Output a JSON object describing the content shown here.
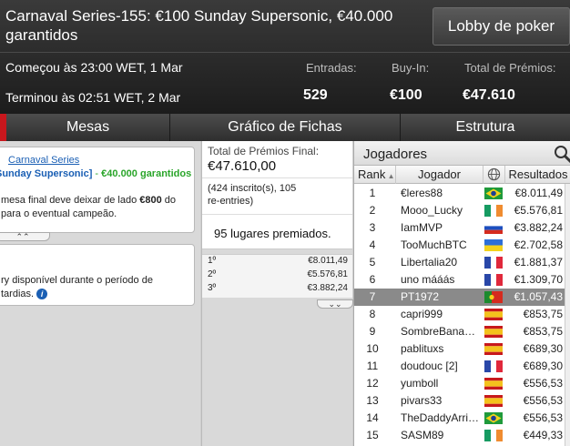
{
  "header": {
    "title": "Carnaval Series-155: €100 Sunday Supersonic, €40.000 garantidos",
    "lobby_button": "Lobby de poker",
    "started": "Começou às 23:00 WET, 1 Mar",
    "ended": "Terminou às 02:51 WET, 2 Mar",
    "entries_label": "Entradas:",
    "entries_value": "529",
    "buyin_label": "Buy-In:",
    "buyin_value": "€100",
    "prize_label": "Total de Prémios:",
    "prize_value": "€47.610"
  },
  "tabs": [
    "Mesas",
    "Gráfico de Fichas",
    "Estrutura"
  ],
  "left": {
    "series_link": "Carnaval Series",
    "event_name": "Sunday Supersonic]",
    "guarantee": "€40.000 garantidos",
    "desc_pre": "mesa final deve deixar de lado ",
    "desc_amount": "€800",
    "desc_post": " do",
    "desc_line2": "para o eventual campeão.",
    "late_line1": "ry disponível durante o período de",
    "late_line2": "tardias."
  },
  "middle": {
    "final_label": "Total de Prémios Final:",
    "final_value": "€47.610,00",
    "entrants_line1": "(424 inscrito(s), 105",
    "entrants_line2": "re-entries)",
    "places": "95 lugares premiados.",
    "payouts": [
      {
        "place": "1º",
        "amount": "€8.011,49"
      },
      {
        "place": "2º",
        "amount": "€5.576,81"
      },
      {
        "place": "3º",
        "amount": "€3.882,24"
      }
    ]
  },
  "players": {
    "title": "Jogadores",
    "columns": {
      "rank": "Rank",
      "player": "Jogador",
      "results": "Resultados"
    },
    "selected_color": "#8a8a8a",
    "rows": [
      {
        "rank": "1",
        "name": "€leres88",
        "flag": "brazil",
        "result": "€8.011,49"
      },
      {
        "rank": "2",
        "name": "Mooo_Lucky",
        "flag": "ireland",
        "result": "€5.576,81"
      },
      {
        "rank": "3",
        "name": "IamMVP",
        "flag": "russia",
        "result": "€3.882,24"
      },
      {
        "rank": "4",
        "name": "TooMuchBTC",
        "flag": "ukraine",
        "result": "€2.702,58"
      },
      {
        "rank": "5",
        "name": "Libertalia20",
        "flag": "france",
        "result": "€1.881,37"
      },
      {
        "rank": "6",
        "name": "uno mááás",
        "flag": "france",
        "result": "€1.309,70"
      },
      {
        "rank": "7",
        "name": "PT1972",
        "flag": "portugal",
        "result": "€1.057,43",
        "selected": true
      },
      {
        "rank": "8",
        "name": "capri999",
        "flag": "spain",
        "result": "€853,75"
      },
      {
        "rank": "9",
        "name": "SombreBana…",
        "flag": "spain",
        "result": "€853,75"
      },
      {
        "rank": "10",
        "name": "pablituxs",
        "flag": "spain",
        "result": "€689,30"
      },
      {
        "rank": "11",
        "name": "doudouc [2]",
        "flag": "france",
        "result": "€689,30"
      },
      {
        "rank": "12",
        "name": "yumboll",
        "flag": "spain",
        "result": "€556,53"
      },
      {
        "rank": "13",
        "name": "pivars33",
        "flag": "spain",
        "result": "€556,53"
      },
      {
        "rank": "14",
        "name": "TheDaddyArri…",
        "flag": "brazil",
        "result": "€556,53"
      },
      {
        "rank": "15",
        "name": "SASM89",
        "flag": "ireland",
        "result": "€449,33"
      }
    ]
  }
}
